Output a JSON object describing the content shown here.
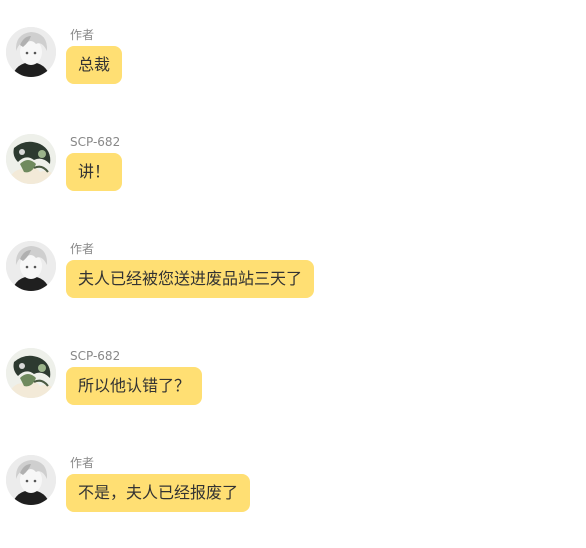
{
  "messages": [
    {
      "name": "作者",
      "avatar": "author-avatar",
      "text": "总裁"
    },
    {
      "name": "SCP-682",
      "avatar": "scp-682-avatar",
      "text": "讲！"
    },
    {
      "name": "作者",
      "avatar": "author-avatar",
      "text": "夫人已经被您送进废品站三天了"
    },
    {
      "name": "SCP-682",
      "avatar": "scp-682-avatar",
      "text": "所以他认错了？"
    },
    {
      "name": "作者",
      "avatar": "author-avatar",
      "text": "不是，夫人已经报废了"
    }
  ],
  "colors": {
    "bubble": "#ffdf73",
    "bubble_text": "#333333",
    "name_text": "#888888",
    "background": "#ffffff"
  }
}
